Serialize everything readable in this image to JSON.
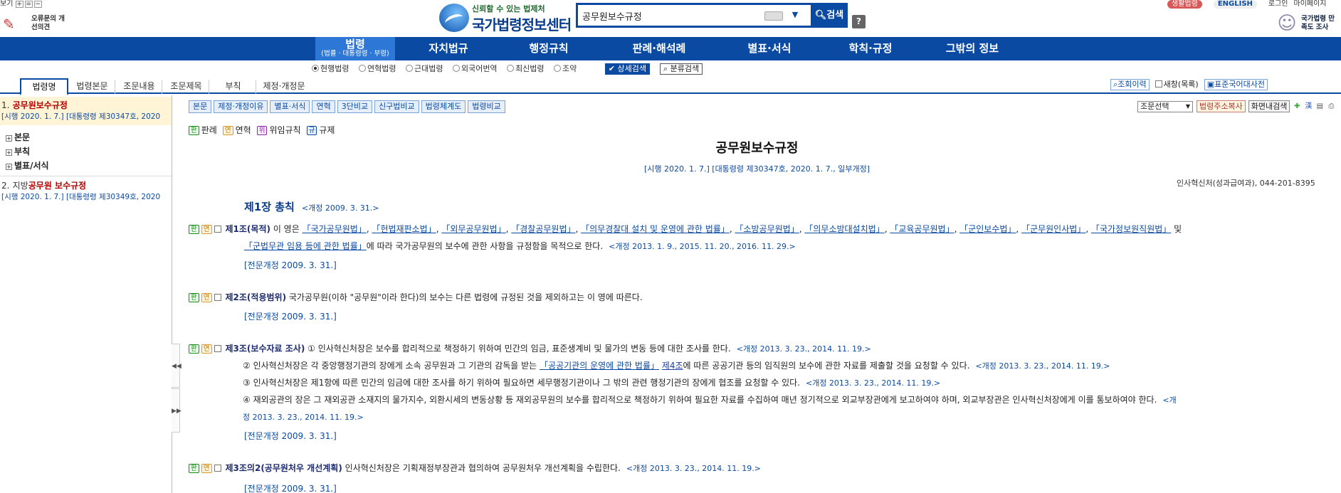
{
  "topbar": {
    "view_ctl_label": "보기",
    "feedback": "오류문의 개선의견",
    "logo_slogan": "신뢰할 수 있는 법제처",
    "logo_title": "국가법령정보센터",
    "search_value": "공무원보수규정",
    "search_button": "검색",
    "help": "?",
    "links": [
      "생활법령",
      "ENGLISH",
      "로그인",
      "마이페이지"
    ],
    "satisfaction": "국가법령 만족도 조사"
  },
  "nav": {
    "items": [
      "법령",
      "자치법규",
      "행정규칙",
      "판례·해석례",
      "별표·서식",
      "학칙·규정",
      "그밖의 정보"
    ],
    "active_sub": "(법률 · 대통령령 · 부령)"
  },
  "options": {
    "radios": [
      "현행법령",
      "연혁법령",
      "근대법령",
      "외국어번역",
      "최신법령",
      "조약"
    ],
    "detail_search": "상세검색",
    "category_search": "분류검색"
  },
  "tabs": [
    "법령명",
    "법령본문",
    "조문내용",
    "조문제목",
    "부칙",
    "제정·개정문"
  ],
  "right_controls": {
    "history": "조회이력",
    "new_window": "새창(목록)",
    "dictionary": "표준국어대사전"
  },
  "results": [
    {
      "num": "1.",
      "title": "공무원보수규정",
      "sub": "[시행 2020. 1. 7.] [대통령령 제30347호, 2020"
    },
    {
      "num": "2.",
      "prefix": "지방",
      "title": "공무원 보수규정",
      "sub": "[시행 2020. 1. 7.] [대통령령 제30349호, 2020"
    }
  ],
  "tree": [
    "본문",
    "부칙",
    "별표/서식"
  ],
  "toolbar": [
    "본문",
    "제정·개정이유",
    "별표·서식",
    "연혁",
    "3단비교",
    "신구법비교",
    "법령체계도",
    "법령비교"
  ],
  "toolbar2": {
    "select": "조문선택",
    "copy": "법령주소복사",
    "screen_search": "화면내검색"
  },
  "legend": {
    "pan": "판",
    "pan_label": "판례",
    "yeon": "연",
    "yeon_label": "연혁",
    "wi": "위",
    "wi_label": "위임규칙",
    "gyu": "규",
    "gyu_label": "규제"
  },
  "doc": {
    "title": "공무원보수규정",
    "info": "[시행 2020. 1. 7.] [대통령령 제30347호, 2020. 1. 7., 일부개정]",
    "ministry": "인사혁신처(성과급여과), 044-201-8395",
    "chapter": "제1장 총칙",
    "chapter_amend": "<개정 2009. 3. 31.>",
    "art1_head": "제1조(목적)",
    "art1_pre": "이 영은",
    "art1_laws": [
      "「국가공무원법」",
      "「헌법재판소법」",
      "「외무공무원법」",
      "「경찰공무원법」",
      "「의무경찰대 설치 및 운영에 관한 법률」",
      "「소방공무원법」",
      "「의무소방대설치법」",
      "「교육공무원법」",
      "「군인보수법」",
      "「군무원인사법」",
      "「국가정보원직원법」"
    ],
    "art1_and": "및",
    "art1_line2_law": "「군법무관 임용 등에 관한 법률」",
    "art1_line2_rest": "에 따라 국가공무원의 보수에 관한 사항을 규정함을 목적으로 한다.",
    "art1_amend": "<개정 2013. 1. 9., 2015. 11. 20., 2016. 11. 29.>",
    "full_rev": "[전문개정 2009. 3. 31.]",
    "art2_head": "제2조(적용범위)",
    "art2_text": "국가공무원(이하 \"공무원\"이라 한다)의 보수는 다른 법령에 규정된 것을 제외하고는 이 영에 따른다.",
    "art3_head": "제3조(보수자료 조사)",
    "art3_p1": "① 인사혁신처장은 보수를 합리적으로 책정하기 위하여 민간의 임금, 표준생계비 및 물가의 변동 등에 대한 조사를 한다.",
    "art3_amend": "<개정 2013. 3. 23., 2014. 11. 19.>",
    "art3_p2_a": "② 인사혁신처장은 각 중앙행정기관의 장에게 소속 공무원과 그 기관의 감독을 받는",
    "art3_p2_law": "「공공기관의 운영에 관한 법률」",
    "art3_p2_art": "제4조",
    "art3_p2_b": "에 따른 공공기관 등의 임직원의 보수에 관한 자료를 제출할 것을 요청할 수 있다.",
    "art3_p3": "③ 인사혁신처장은 제1항에 따른 민간의 임금에 대한 조사를 하기 위하여 필요하면 세무행정기관이나 그 밖의 관련 행정기관의 장에게 협조를 요청할 수 있다.",
    "art3_p4": "④ 재외공관의 장은 그 재외공관 소재지의 물가지수, 외환시세의 변동상황 등 재외공무원의 보수를 합리적으로 책정하기 위하여 필요한 자료를 수집하여 매년 정기적으로 외교부장관에게 보고하여야 하며, 외교부장관은 인사혁신처장에게 이를 통보하여야 한다.",
    "art3_p4_amend_a": "<개",
    "art3_p4_amend_b": "정 2013. 3. 23., 2014. 11. 19.>",
    "art3b_head": "제3조의2(공무원처우 개선계획)",
    "art3b_text": "인사혁신처장은 기획재정부장관과 협의하여 공무원처우 개선계획을 수립한다."
  }
}
